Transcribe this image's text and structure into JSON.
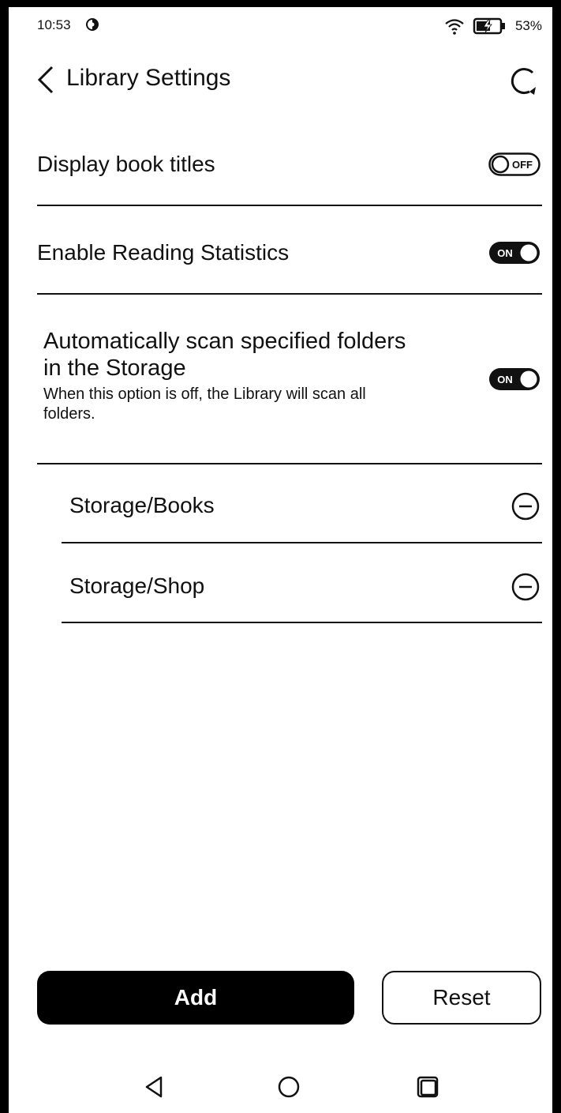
{
  "status_bar": {
    "time": "10:53",
    "battery_percent": "53%",
    "icons": [
      "sync-icon",
      "wifi-icon",
      "battery-charging-icon"
    ]
  },
  "header": {
    "title": "Library Settings",
    "back_icon": "chevron-left-icon",
    "refresh_icon": "refresh-icon"
  },
  "settings": [
    {
      "label": "Display book titles",
      "toggle": "OFF"
    },
    {
      "label": "Enable Reading Statistics",
      "toggle": "ON"
    },
    {
      "label": "Automatically scan specified folders in the Storage",
      "label_line1": "Automatically scan specified folders",
      "label_line2": "in the Storage",
      "description": "When this option is off, the Library will scan all folders.",
      "desc_line1": "When this option is off, the Library will scan all",
      "desc_line2": "folders.",
      "toggle": "ON"
    }
  ],
  "folders": [
    {
      "path": "Storage/Books",
      "action_icon": "minus-circle-icon"
    },
    {
      "path": "Storage/Shop",
      "action_icon": "minus-circle-icon"
    }
  ],
  "buttons": {
    "add": "Add",
    "reset": "Reset"
  },
  "nav_bar": {
    "icons": [
      "back-triangle-icon",
      "home-circle-icon",
      "recents-square-icon"
    ]
  },
  "colors": {
    "foreground": "#111111",
    "background": "#ffffff",
    "accent": "#000000"
  }
}
